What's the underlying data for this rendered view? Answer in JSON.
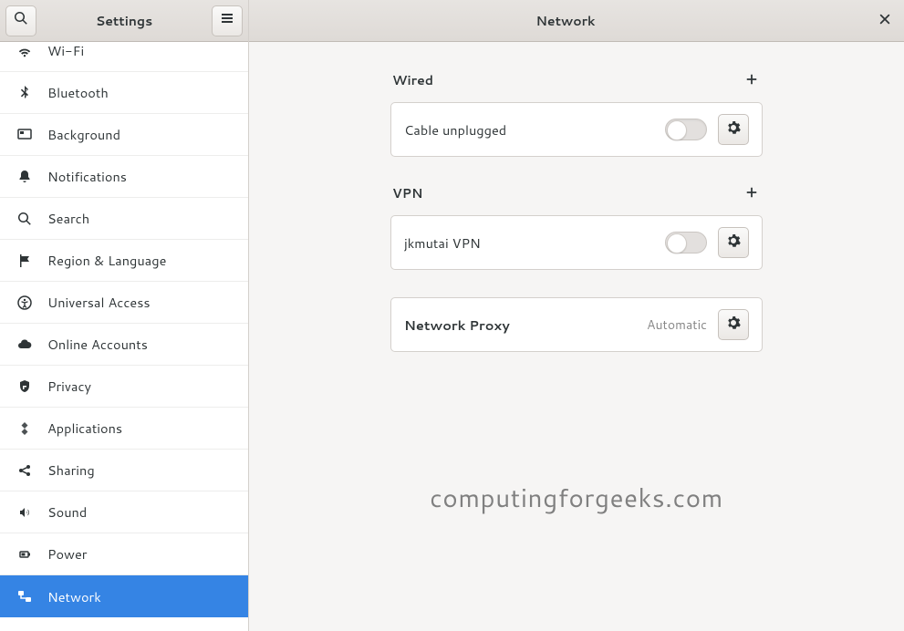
{
  "sidebar": {
    "title": "Settings",
    "items": [
      {
        "label": "Wi-Fi",
        "icon": "wifi"
      },
      {
        "label": "Bluetooth",
        "icon": "bluetooth"
      },
      {
        "label": "Background",
        "icon": "background"
      },
      {
        "label": "Notifications",
        "icon": "notifications"
      },
      {
        "label": "Search",
        "icon": "search"
      },
      {
        "label": "Region & Language",
        "icon": "region"
      },
      {
        "label": "Universal Access",
        "icon": "universal"
      },
      {
        "label": "Online Accounts",
        "icon": "online"
      },
      {
        "label": "Privacy",
        "icon": "privacy"
      },
      {
        "label": "Applications",
        "icon": "applications"
      },
      {
        "label": "Sharing",
        "icon": "sharing"
      },
      {
        "label": "Sound",
        "icon": "sound"
      },
      {
        "label": "Power",
        "icon": "power"
      },
      {
        "label": "Network",
        "icon": "network",
        "selected": true
      }
    ]
  },
  "content": {
    "title": "Network",
    "sections": {
      "wired": {
        "heading": "Wired",
        "row_label": "Cable unplugged"
      },
      "vpn": {
        "heading": "VPN",
        "row_label": "jkmutai VPN"
      },
      "proxy": {
        "row_label": "Network Proxy",
        "status": "Automatic"
      }
    }
  },
  "watermark": "computingforgeeks.com"
}
